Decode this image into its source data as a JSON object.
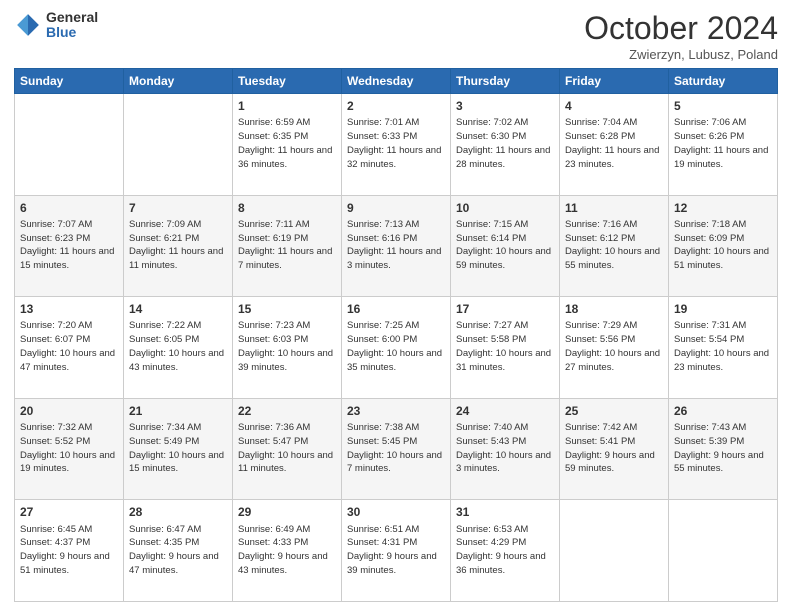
{
  "logo": {
    "general": "General",
    "blue": "Blue"
  },
  "title": "October 2024",
  "subtitle": "Zwierzyn, Lubusz, Poland",
  "days_of_week": [
    "Sunday",
    "Monday",
    "Tuesday",
    "Wednesday",
    "Thursday",
    "Friday",
    "Saturday"
  ],
  "weeks": [
    [
      {
        "day": "",
        "sunrise": "",
        "sunset": "",
        "daylight": ""
      },
      {
        "day": "",
        "sunrise": "",
        "sunset": "",
        "daylight": ""
      },
      {
        "day": "1",
        "sunrise": "Sunrise: 6:59 AM",
        "sunset": "Sunset: 6:35 PM",
        "daylight": "Daylight: 11 hours and 36 minutes."
      },
      {
        "day": "2",
        "sunrise": "Sunrise: 7:01 AM",
        "sunset": "Sunset: 6:33 PM",
        "daylight": "Daylight: 11 hours and 32 minutes."
      },
      {
        "day": "3",
        "sunrise": "Sunrise: 7:02 AM",
        "sunset": "Sunset: 6:30 PM",
        "daylight": "Daylight: 11 hours and 28 minutes."
      },
      {
        "day": "4",
        "sunrise": "Sunrise: 7:04 AM",
        "sunset": "Sunset: 6:28 PM",
        "daylight": "Daylight: 11 hours and 23 minutes."
      },
      {
        "day": "5",
        "sunrise": "Sunrise: 7:06 AM",
        "sunset": "Sunset: 6:26 PM",
        "daylight": "Daylight: 11 hours and 19 minutes."
      }
    ],
    [
      {
        "day": "6",
        "sunrise": "Sunrise: 7:07 AM",
        "sunset": "Sunset: 6:23 PM",
        "daylight": "Daylight: 11 hours and 15 minutes."
      },
      {
        "day": "7",
        "sunrise": "Sunrise: 7:09 AM",
        "sunset": "Sunset: 6:21 PM",
        "daylight": "Daylight: 11 hours and 11 minutes."
      },
      {
        "day": "8",
        "sunrise": "Sunrise: 7:11 AM",
        "sunset": "Sunset: 6:19 PM",
        "daylight": "Daylight: 11 hours and 7 minutes."
      },
      {
        "day": "9",
        "sunrise": "Sunrise: 7:13 AM",
        "sunset": "Sunset: 6:16 PM",
        "daylight": "Daylight: 11 hours and 3 minutes."
      },
      {
        "day": "10",
        "sunrise": "Sunrise: 7:15 AM",
        "sunset": "Sunset: 6:14 PM",
        "daylight": "Daylight: 10 hours and 59 minutes."
      },
      {
        "day": "11",
        "sunrise": "Sunrise: 7:16 AM",
        "sunset": "Sunset: 6:12 PM",
        "daylight": "Daylight: 10 hours and 55 minutes."
      },
      {
        "day": "12",
        "sunrise": "Sunrise: 7:18 AM",
        "sunset": "Sunset: 6:09 PM",
        "daylight": "Daylight: 10 hours and 51 minutes."
      }
    ],
    [
      {
        "day": "13",
        "sunrise": "Sunrise: 7:20 AM",
        "sunset": "Sunset: 6:07 PM",
        "daylight": "Daylight: 10 hours and 47 minutes."
      },
      {
        "day": "14",
        "sunrise": "Sunrise: 7:22 AM",
        "sunset": "Sunset: 6:05 PM",
        "daylight": "Daylight: 10 hours and 43 minutes."
      },
      {
        "day": "15",
        "sunrise": "Sunrise: 7:23 AM",
        "sunset": "Sunset: 6:03 PM",
        "daylight": "Daylight: 10 hours and 39 minutes."
      },
      {
        "day": "16",
        "sunrise": "Sunrise: 7:25 AM",
        "sunset": "Sunset: 6:00 PM",
        "daylight": "Daylight: 10 hours and 35 minutes."
      },
      {
        "day": "17",
        "sunrise": "Sunrise: 7:27 AM",
        "sunset": "Sunset: 5:58 PM",
        "daylight": "Daylight: 10 hours and 31 minutes."
      },
      {
        "day": "18",
        "sunrise": "Sunrise: 7:29 AM",
        "sunset": "Sunset: 5:56 PM",
        "daylight": "Daylight: 10 hours and 27 minutes."
      },
      {
        "day": "19",
        "sunrise": "Sunrise: 7:31 AM",
        "sunset": "Sunset: 5:54 PM",
        "daylight": "Daylight: 10 hours and 23 minutes."
      }
    ],
    [
      {
        "day": "20",
        "sunrise": "Sunrise: 7:32 AM",
        "sunset": "Sunset: 5:52 PM",
        "daylight": "Daylight: 10 hours and 19 minutes."
      },
      {
        "day": "21",
        "sunrise": "Sunrise: 7:34 AM",
        "sunset": "Sunset: 5:49 PM",
        "daylight": "Daylight: 10 hours and 15 minutes."
      },
      {
        "day": "22",
        "sunrise": "Sunrise: 7:36 AM",
        "sunset": "Sunset: 5:47 PM",
        "daylight": "Daylight: 10 hours and 11 minutes."
      },
      {
        "day": "23",
        "sunrise": "Sunrise: 7:38 AM",
        "sunset": "Sunset: 5:45 PM",
        "daylight": "Daylight: 10 hours and 7 minutes."
      },
      {
        "day": "24",
        "sunrise": "Sunrise: 7:40 AM",
        "sunset": "Sunset: 5:43 PM",
        "daylight": "Daylight: 10 hours and 3 minutes."
      },
      {
        "day": "25",
        "sunrise": "Sunrise: 7:42 AM",
        "sunset": "Sunset: 5:41 PM",
        "daylight": "Daylight: 9 hours and 59 minutes."
      },
      {
        "day": "26",
        "sunrise": "Sunrise: 7:43 AM",
        "sunset": "Sunset: 5:39 PM",
        "daylight": "Daylight: 9 hours and 55 minutes."
      }
    ],
    [
      {
        "day": "27",
        "sunrise": "Sunrise: 6:45 AM",
        "sunset": "Sunset: 4:37 PM",
        "daylight": "Daylight: 9 hours and 51 minutes."
      },
      {
        "day": "28",
        "sunrise": "Sunrise: 6:47 AM",
        "sunset": "Sunset: 4:35 PM",
        "daylight": "Daylight: 9 hours and 47 minutes."
      },
      {
        "day": "29",
        "sunrise": "Sunrise: 6:49 AM",
        "sunset": "Sunset: 4:33 PM",
        "daylight": "Daylight: 9 hours and 43 minutes."
      },
      {
        "day": "30",
        "sunrise": "Sunrise: 6:51 AM",
        "sunset": "Sunset: 4:31 PM",
        "daylight": "Daylight: 9 hours and 39 minutes."
      },
      {
        "day": "31",
        "sunrise": "Sunrise: 6:53 AM",
        "sunset": "Sunset: 4:29 PM",
        "daylight": "Daylight: 9 hours and 36 minutes."
      },
      {
        "day": "",
        "sunrise": "",
        "sunset": "",
        "daylight": ""
      },
      {
        "day": "",
        "sunrise": "",
        "sunset": "",
        "daylight": ""
      }
    ]
  ]
}
